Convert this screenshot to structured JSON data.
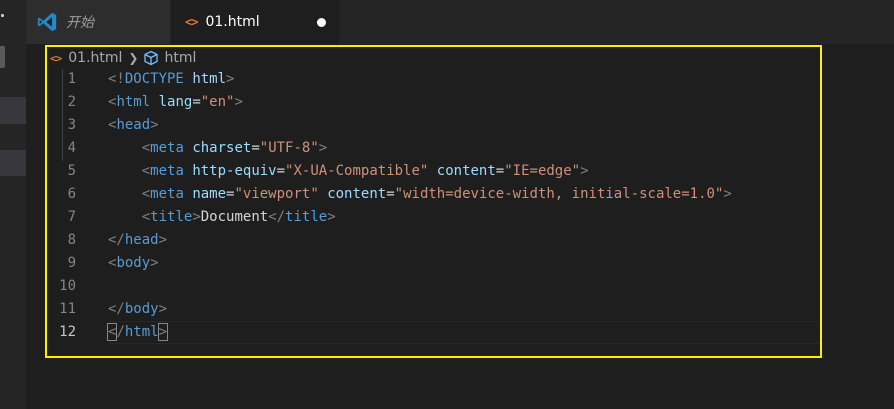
{
  "tabs": {
    "start": {
      "label": "开始",
      "icon": "vscode-logo-icon"
    },
    "file": {
      "label": "01.html",
      "icon": "html-code-icon",
      "dirty": true
    }
  },
  "breadcrumb": {
    "file": "01.html",
    "symbol": "html"
  },
  "editor": {
    "current_line": 12,
    "line_numbers": [
      "1",
      "2",
      "3",
      "4",
      "5",
      "6",
      "7",
      "8",
      "9",
      "10",
      "11",
      "12"
    ]
  }
}
